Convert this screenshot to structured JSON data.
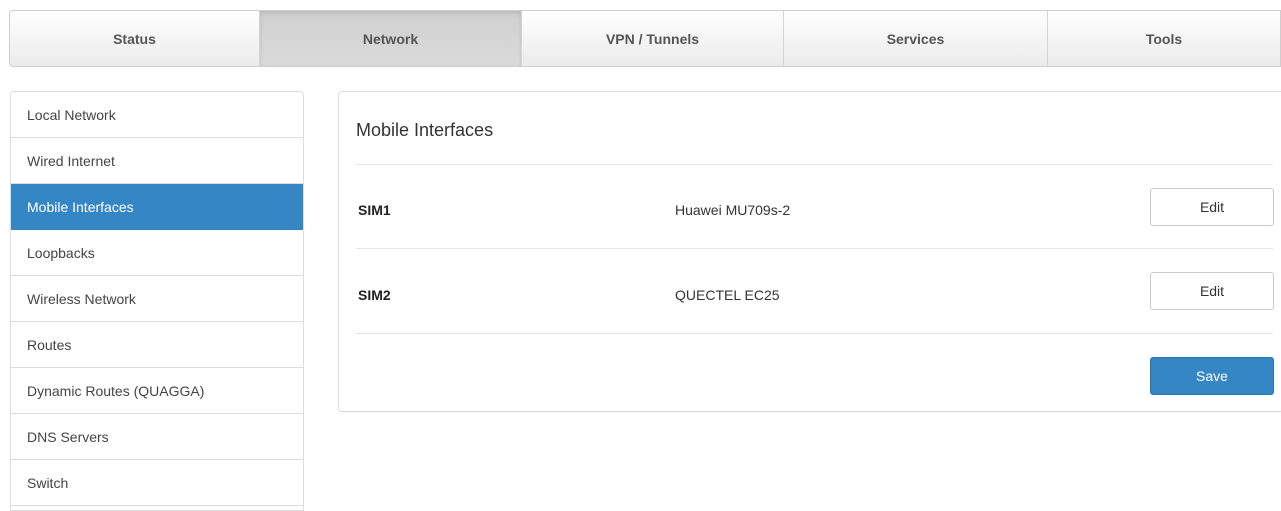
{
  "topnav": {
    "tabs": [
      {
        "label": "Status"
      },
      {
        "label": "Network"
      },
      {
        "label": "VPN / Tunnels"
      },
      {
        "label": "Services"
      },
      {
        "label": "Tools"
      }
    ],
    "active": "Network"
  },
  "sidebar": {
    "items": [
      {
        "label": "Local Network"
      },
      {
        "label": "Wired Internet"
      },
      {
        "label": "Mobile Interfaces"
      },
      {
        "label": "Loopbacks"
      },
      {
        "label": "Wireless Network"
      },
      {
        "label": "Routes"
      },
      {
        "label": "Dynamic Routes (QUAGGA)"
      },
      {
        "label": "DNS Servers"
      },
      {
        "label": "Switch"
      }
    ],
    "active": "Mobile Interfaces"
  },
  "panel": {
    "title": "Mobile Interfaces",
    "rows": [
      {
        "name": "SIM1",
        "modem": "Huawei MU709s-2",
        "action": "Edit"
      },
      {
        "name": "SIM2",
        "modem": "QUECTEL EC25",
        "action": "Edit"
      }
    ],
    "save_label": "Save"
  },
  "colors": {
    "accent": "#3586c5",
    "border": "#dddddd",
    "text": "#333333"
  }
}
